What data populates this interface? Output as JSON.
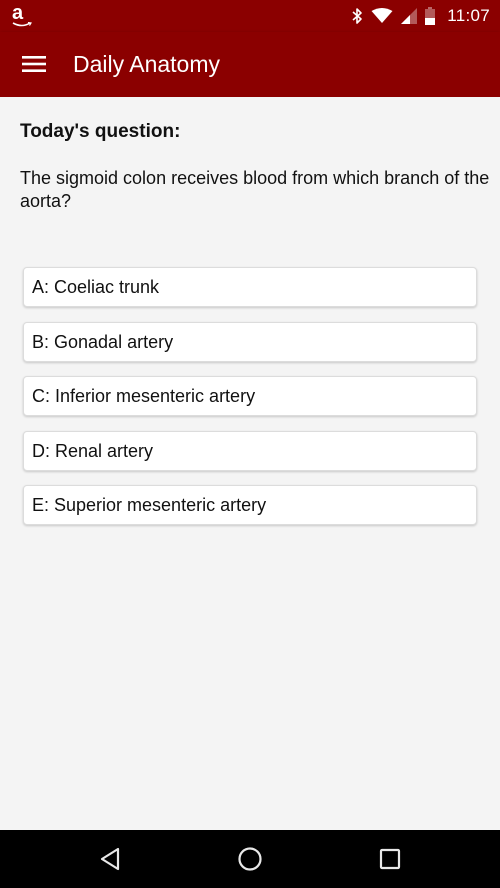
{
  "status_bar": {
    "left_icon": "amazon-logo-icon",
    "amazon_glyph": "a",
    "icons": [
      "bluetooth-icon",
      "wifi-icon",
      "cell-signal-icon",
      "battery-icon"
    ],
    "time": "11:07"
  },
  "app_bar": {
    "menu_icon": "hamburger-menu-icon",
    "title": "Daily Anatomy"
  },
  "question": {
    "heading": "Today's question:",
    "text": "The sigmoid colon receives blood from which branch of the aorta?"
  },
  "answers": [
    {
      "label": "A: Coeliac trunk"
    },
    {
      "label": "B: Gonadal artery"
    },
    {
      "label": "C: Inferior mesenteric artery"
    },
    {
      "label": "D: Renal artery"
    },
    {
      "label": "E: Superior mesenteric artery"
    }
  ],
  "nav_bar": {
    "buttons": [
      "back-icon",
      "home-icon",
      "recents-icon"
    ]
  },
  "colors": {
    "primary": "#8b0000",
    "background": "#f4f4f4",
    "card": "#ffffff",
    "nav_bar": "#000000"
  }
}
